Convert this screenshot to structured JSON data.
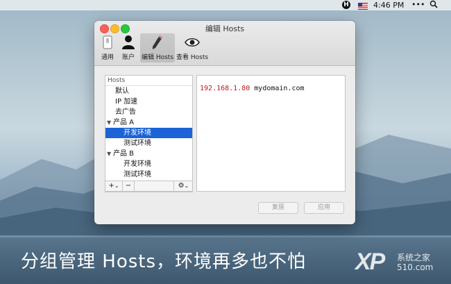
{
  "menubar": {
    "h_icon": "H",
    "flag_icon": "us-flag-icon",
    "time": "4:46 PM",
    "more": "•••",
    "search_icon": "magnifier-icon"
  },
  "window": {
    "title": "编辑 Hosts",
    "toolbar": [
      {
        "label": "通用",
        "icon": "switch-icon"
      },
      {
        "label": "账户",
        "icon": "person-icon"
      },
      {
        "label": "编辑 Hosts",
        "icon": "pencil-icon",
        "selected": true
      },
      {
        "label": "查看 Hosts",
        "icon": "eye-icon"
      }
    ]
  },
  "sidebar": {
    "header": "Hosts",
    "items": [
      {
        "label": "默认",
        "indent": 1,
        "selected": false,
        "group": false
      },
      {
        "label": "IP 加速",
        "indent": 1,
        "selected": false,
        "group": false
      },
      {
        "label": "去广告",
        "indent": 1,
        "selected": false,
        "group": false
      },
      {
        "label": "产品 A",
        "indent": 0,
        "selected": false,
        "group": true
      },
      {
        "label": "开发环境",
        "indent": 2,
        "selected": true,
        "group": false
      },
      {
        "label": "测试环境",
        "indent": 2,
        "selected": false,
        "group": false
      },
      {
        "label": "产品 B",
        "indent": 0,
        "selected": false,
        "group": true
      },
      {
        "label": "开发环境",
        "indent": 2,
        "selected": false,
        "group": false
      },
      {
        "label": "测试环境",
        "indent": 2,
        "selected": false,
        "group": false
      }
    ],
    "add_btn": "+",
    "add_caret": "⌄",
    "remove_btn": "−",
    "gear_btn": "⚙",
    "gear_caret": "⌄"
  },
  "editor": {
    "ip": "192.168.1.80",
    "domain": "mydomain.com"
  },
  "buttons": {
    "revert": "复原",
    "apply": "应用"
  },
  "caption": "分组管理 Hosts，环境再多也不怕",
  "watermark": {
    "logo": "XP",
    "site": "系统之家",
    "number": "510.com"
  }
}
